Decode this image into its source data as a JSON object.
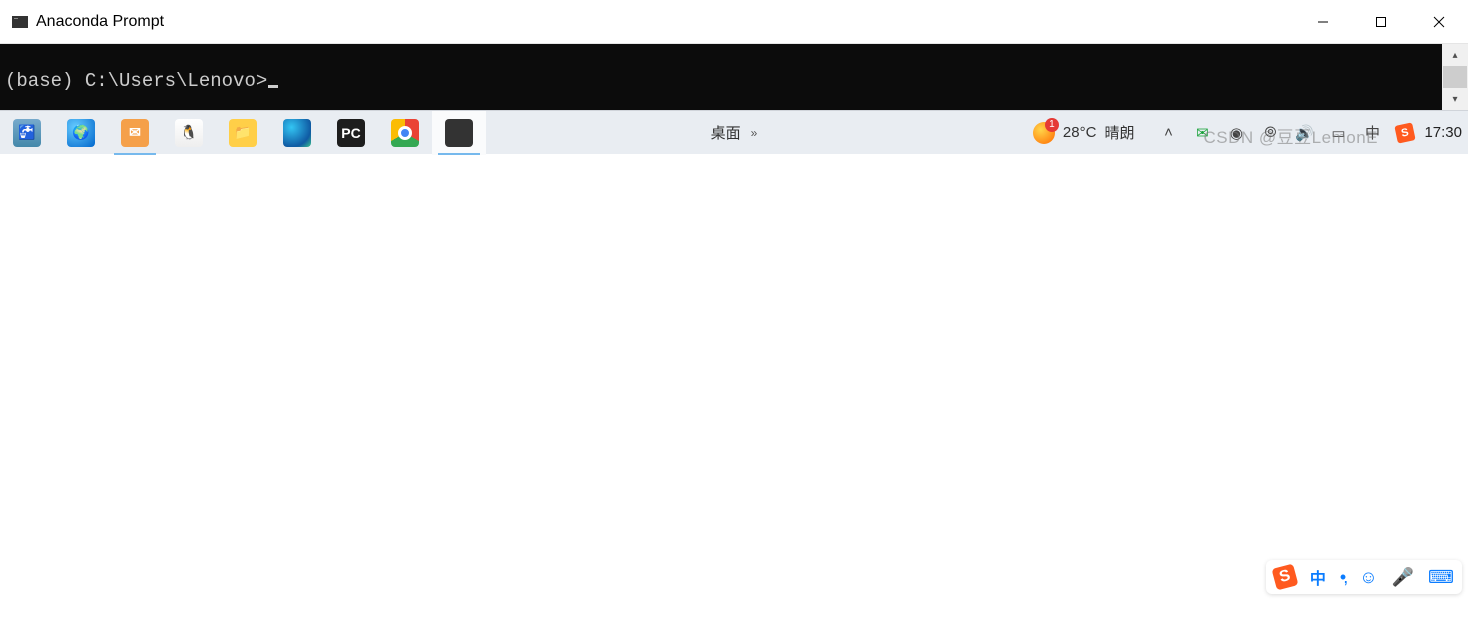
{
  "window": {
    "title": "Anaconda Prompt"
  },
  "terminal": {
    "prompt": "(base) C:\\Users\\Lenovo>"
  },
  "ime": {
    "logo_text": "S",
    "zhong": "中"
  },
  "taskbar": {
    "center_label": "桌面",
    "weather": {
      "temp": "28°C",
      "cond": "晴朗",
      "badge": "1"
    },
    "clock": "17:30"
  },
  "watermark": "CSDN @豆豆LemonE"
}
